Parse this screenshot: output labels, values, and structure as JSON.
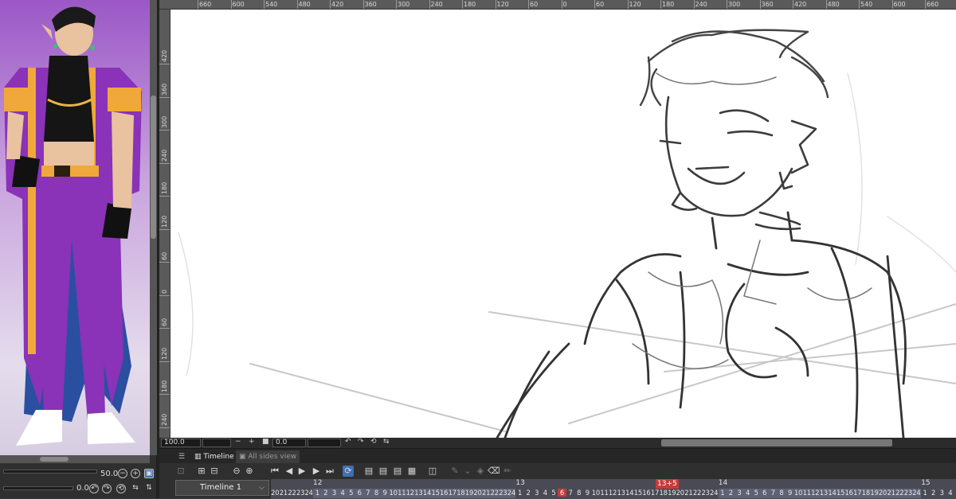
{
  "navigator": {
    "zoom_value": "50.0",
    "rotation_value": "0.0"
  },
  "ruler_top": {
    "labels": [
      "660",
      "600",
      "540",
      "480",
      "420",
      "360",
      "300",
      "240",
      "180",
      "120",
      "60",
      "0",
      "60",
      "120",
      "180",
      "240",
      "300",
      "360",
      "420",
      "480",
      "540",
      "600",
      "660"
    ]
  },
  "ruler_left": {
    "labels": [
      "420",
      "360",
      "300",
      "240",
      "180",
      "120",
      "60",
      "0",
      "60",
      "120",
      "180",
      "240"
    ]
  },
  "canvas_bar": {
    "zoom_field": "100.0",
    "angle_field": "0.0"
  },
  "timeline": {
    "tabs": [
      {
        "label": "Timeline",
        "active": true
      },
      {
        "label": "All sides view",
        "active": false
      }
    ],
    "selected_timeline": "Timeline 1",
    "playhead_label": "13+5",
    "major_frames": [
      "12",
      "13",
      "14",
      "15"
    ]
  },
  "colors": {
    "accent_active": "#3f6fb5",
    "playhead": "#c83a3a"
  }
}
